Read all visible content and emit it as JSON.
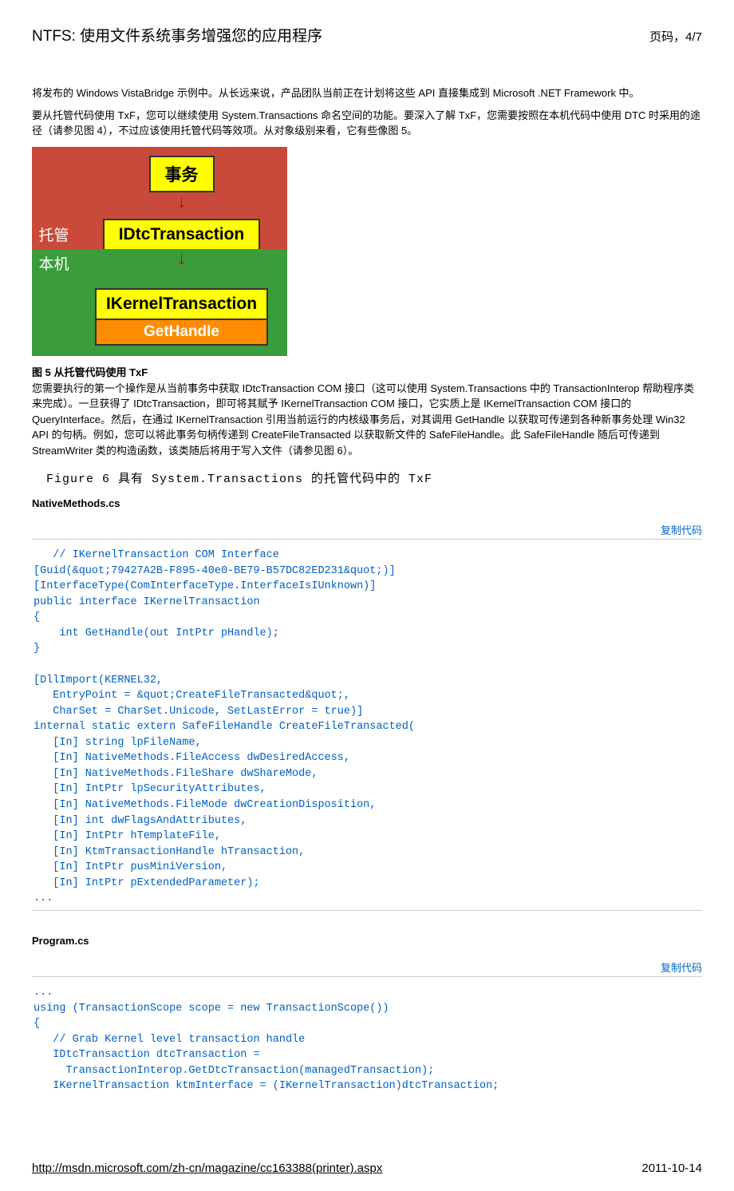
{
  "header": {
    "title": "NTFS: 使用文件系统事务增强您的应用程序",
    "page_label": "页码，4/7"
  },
  "para1": "将发布的 Windows VistaBridge 示例中。从长远来说，产品团队当前正在计划将这些 API 直接集成到 Microsoft .NET Framework 中。",
  "para2": "要从托管代码使用 TxF，您可以继续使用 System.Transactions 命名空间的功能。要深入了解 TxF，您需要按照在本机代码中使用 DTC 时采用的途径（请参见图 4），不过应该使用托管代码等效项。从对象级别来看，它有些像图 5。",
  "diagram": {
    "box1": "事务",
    "label_managed": "托管",
    "box2": "IDtcTransaction",
    "label_native": "本机",
    "box3_top": "IKernelTransaction",
    "box3_bottom": "GetHandle"
  },
  "caption_fig5": "图 5 从托管代码使用 TxF",
  "para3": "您需要执行的第一个操作是从当前事务中获取 IDtcTransaction COM 接口（这可以使用 System.Transactions 中的 TransactionInterop 帮助程序类来完成）。一旦获得了 IDtcTransaction，即可将其赋予 IKernelTransaction COM 接口，它实质上是 IKernelTransaction COM 接口的 QueryInterface。然后，在通过 IKernelTransaction 引用当前运行的内核级事务后，对其调用 GetHandle 以获取可传递到各种新事务处理 Win32 API 的句柄。例如，您可以将此事务句柄传递到 CreateFileTransacted 以获取新文件的 SafeFileHandle。此 SafeFileHandle 随后可传递到 StreamWriter 类的构造函数，该类随后将用于写入文件（请参见图 6）。",
  "figure6_title": "Figure 6 具有 System.Transactions 的托管代码中的 TxF",
  "file1_name": "NativeMethods.cs",
  "copy_label": "复制代码",
  "code1": "   // IKernelTransaction COM Interface\n[Guid(&quot;79427A2B-F895-40e0-BE79-B57DC82ED231&quot;)]\n[InterfaceType(ComInterfaceType.InterfaceIsIUnknown)]\npublic interface IKernelTransaction\n{\n    int GetHandle(out IntPtr pHandle);\n}\n\n[DllImport(KERNEL32,\n   EntryPoint = &quot;CreateFileTransacted&quot;,\n   CharSet = CharSet.Unicode, SetLastError = true)]\ninternal static extern SafeFileHandle CreateFileTransacted(\n   [In] string lpFileName,\n   [In] NativeMethods.FileAccess dwDesiredAccess,\n   [In] NativeMethods.FileShare dwShareMode,\n   [In] IntPtr lpSecurityAttributes,\n   [In] NativeMethods.FileMode dwCreationDisposition,\n   [In] int dwFlagsAndAttributes,\n   [In] IntPtr hTemplateFile,\n   [In] KtmTransactionHandle hTransaction,\n   [In] IntPtr pusMiniVersion,\n   [In] IntPtr pExtendedParameter);\n...",
  "file2_name": "Program.cs",
  "code2": "...     \nusing (TransactionScope scope = new TransactionScope())\n{\n   // Grab Kernel level transaction handle\n   IDtcTransaction dtcTransaction = \n     TransactionInterop.GetDtcTransaction(managedTransaction);\n   IKernelTransaction ktmInterface = (IKernelTransaction)dtcTransaction;",
  "footer": {
    "url": "http://msdn.microsoft.com/zh-cn/magazine/cc163388(printer).aspx",
    "date": "2011-10-14"
  }
}
